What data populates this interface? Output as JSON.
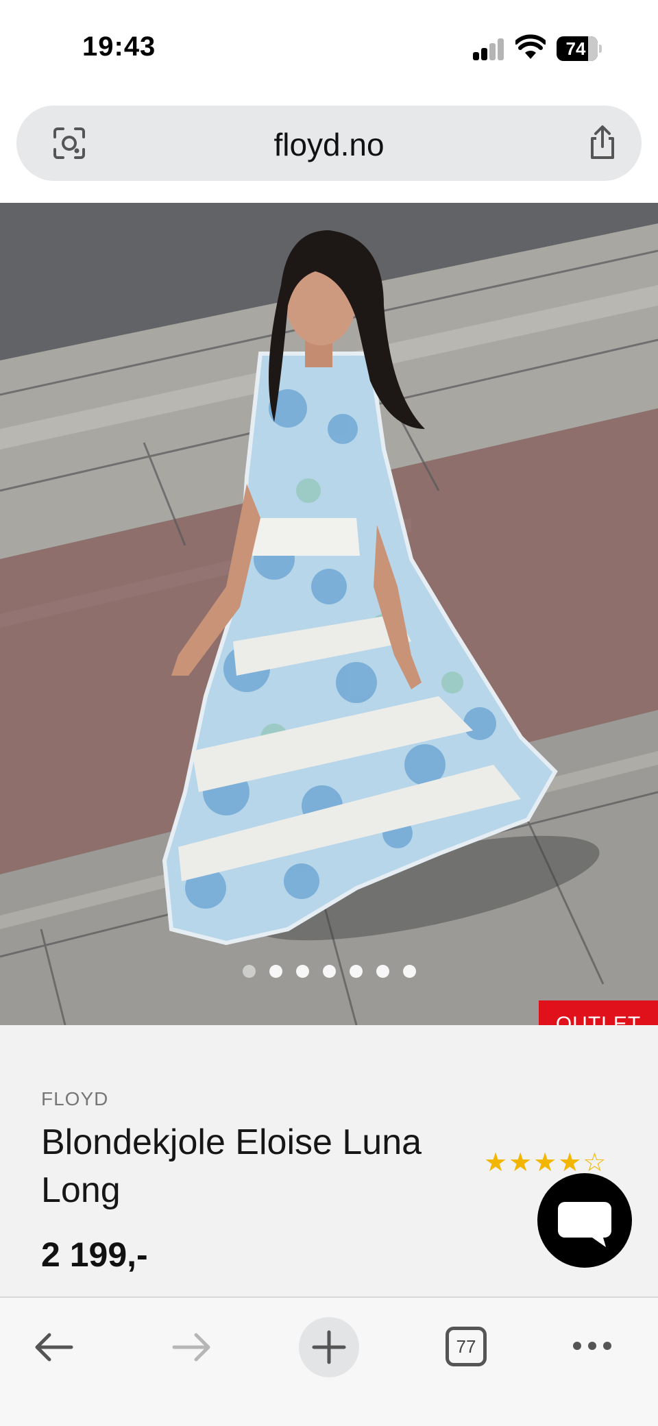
{
  "status_bar": {
    "time": "19:43",
    "battery": "74",
    "icons": [
      "signal-icon",
      "wifi-icon",
      "battery-icon"
    ]
  },
  "address_bar": {
    "url": "floyd.no",
    "left_icon": "lens-icon",
    "right_icon": "share-icon"
  },
  "product_image": {
    "carousel_dot_count": 7,
    "active_dot_index": 0,
    "badge": "OUTLET"
  },
  "product": {
    "brand": "FLOYD",
    "title": "Blondekjole Eloise Luna Long",
    "price": "2 199,-",
    "rating_stars": 4,
    "rating_max": 5
  },
  "chat": {
    "icon": "chat-bubble-icon"
  },
  "toolbar": {
    "tab_count": "77",
    "icons": [
      "back-arrow-icon",
      "forward-arrow-icon",
      "plus-icon",
      "tabs-icon",
      "more-dots-icon"
    ]
  },
  "colors": {
    "badge_red": "#e0111b",
    "star_gold": "#f2b600",
    "info_bg": "#f2f2f3",
    "url_bar_bg": "#e6e8ea"
  }
}
